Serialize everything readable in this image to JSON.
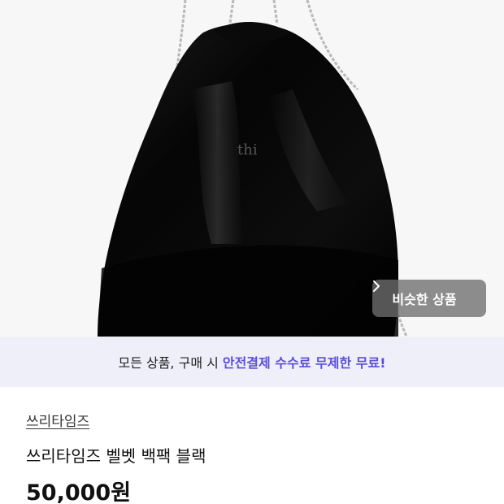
{
  "hero": {
    "image_alt": "black velvet drawstring backpack with silver chains",
    "similar_button_label": "비슷한 상품"
  },
  "banner": {
    "text": "모든 상품, 구매 시",
    "highlight": "안전결제 수수료 무제한 무료!"
  },
  "product": {
    "seller": "쓰리타임즈",
    "title": "쓰리타임즈 벨벳 백팩 블랙",
    "price": "50,000원"
  }
}
